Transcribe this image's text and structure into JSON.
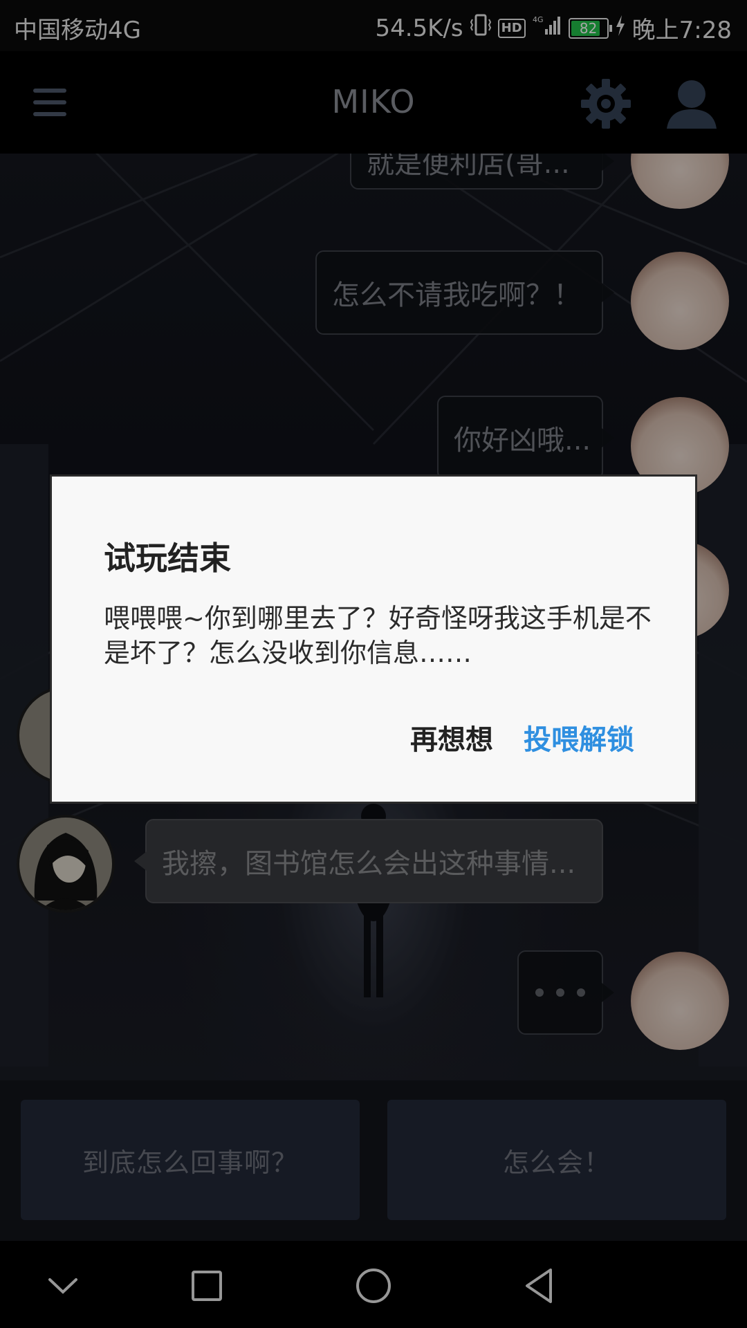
{
  "status_bar": {
    "carrier": "中国移动4G",
    "speed": "54.5K/s",
    "hd": "HD",
    "network": "4G",
    "battery_level": "82",
    "battery_fraction": 0.82,
    "time": "晚上7:28"
  },
  "app_bar": {
    "title": "MIKO",
    "menu_icon": "hamburger-menu-icon",
    "settings_icon": "gear-icon",
    "profile_icon": "user-icon"
  },
  "messages": [
    {
      "side": "right",
      "text": "就是便利店(哥..."
    },
    {
      "side": "right",
      "text": "怎么不请我吃啊？！"
    },
    {
      "side": "right",
      "text": "你好凶哦..."
    },
    {
      "side": "left",
      "text": "我擦，图书馆怎么会出这种事情..."
    },
    {
      "side": "right",
      "typing": true
    }
  ],
  "choices": [
    {
      "label": "到底怎么回事啊？"
    },
    {
      "label": "怎么会！"
    }
  ],
  "dialog": {
    "title": "试玩结束",
    "body": "喂喂喂~你到哪里去了？好奇怪呀我这手机是不是坏了？怎么没收到你信息……",
    "cancel_label": "再想想",
    "confirm_label": "投喂解锁",
    "confirm_color": "#2f8fe0"
  },
  "nav_bar": {
    "icons": [
      "chevron-down-icon",
      "square-recents-icon",
      "circle-home-icon",
      "triangle-back-icon"
    ]
  }
}
